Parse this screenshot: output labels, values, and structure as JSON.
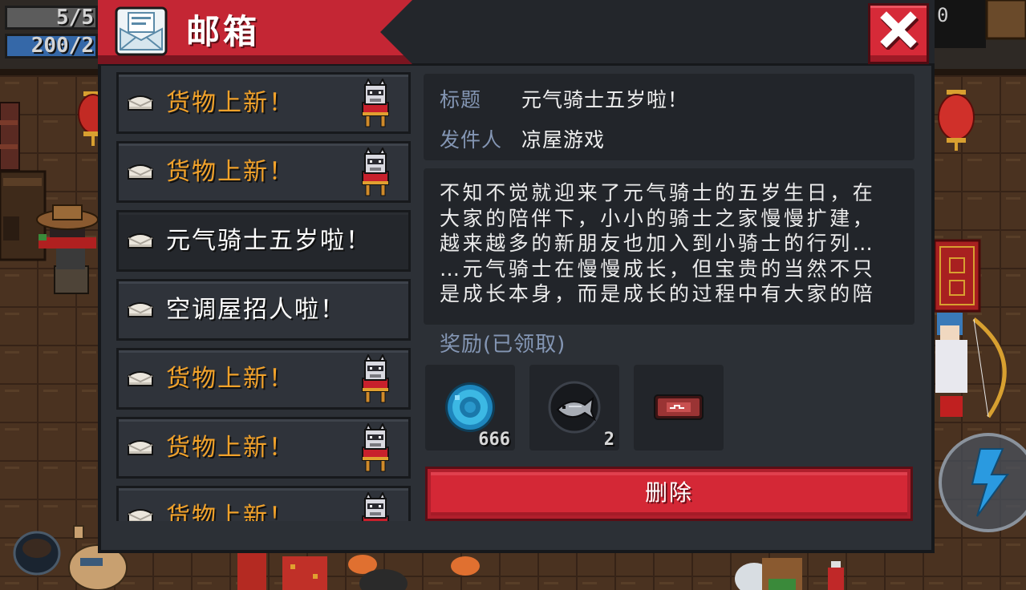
{
  "hud": {
    "health_text": "5/5",
    "energy_text": "200/2",
    "coin_text": "0"
  },
  "mailbox": {
    "title": "邮箱",
    "header_icon": "mail-envelope-icon",
    "close_icon": "close-icon"
  },
  "mail_list": [
    {
      "subject": "货物上新！",
      "color": "#f2a22a",
      "envelope_icon": "envelope-icon",
      "sender_icon": "merchant-cat-icon",
      "selected": false
    },
    {
      "subject": "货物上新！",
      "color": "#f2a22a",
      "envelope_icon": "envelope-icon",
      "sender_icon": "merchant-cat-icon",
      "selected": false
    },
    {
      "subject": "元气骑士五岁啦！",
      "color": "#ffffff",
      "envelope_icon": "envelope-icon",
      "sender_icon": null,
      "selected": true
    },
    {
      "subject": "空调屋招人啦！",
      "color": "#ffffff",
      "envelope_icon": "envelope-icon",
      "sender_icon": null,
      "selected": false
    },
    {
      "subject": "货物上新！",
      "color": "#f2a22a",
      "envelope_icon": "envelope-icon",
      "sender_icon": "merchant-cat-icon",
      "selected": false
    },
    {
      "subject": "货物上新！",
      "color": "#f2a22a",
      "envelope_icon": "envelope-icon",
      "sender_icon": "merchant-cat-icon",
      "selected": false
    },
    {
      "subject": "货物上新！",
      "color": "#f2a22a",
      "envelope_icon": "envelope-icon",
      "sender_icon": "merchant-cat-icon",
      "selected": false
    }
  ],
  "detail": {
    "title_label": "标题",
    "title": "元气骑士五岁啦！",
    "sender_label": "发件人",
    "sender": "凉屋游戏",
    "body_lines": [
      "不知不觉就迎来了元气骑士的五岁生日，在",
      "大家的陪伴下，小小的骑士之家慢慢扩建，",
      "越来越多的新朋友也加入到小骑士的行列…",
      "…元气骑士在慢慢成长，但宝贵的当然不只",
      "是成长本身，而是成长的过程中有大家的陪"
    ]
  },
  "rewards": {
    "label": "奖励(已领取)",
    "items": [
      {
        "icon": "blue-gem-icon",
        "count": "666"
      },
      {
        "icon": "fish-icon",
        "count": "2"
      },
      {
        "icon": "ticket-icon"
      }
    ]
  },
  "delete_button": {
    "label": "删除"
  },
  "skill_button": {
    "icon": "lightning-icon"
  },
  "colors": {
    "panel_background": "#2c3036",
    "header_red": "#c42634",
    "new_goods_orange": "#f2a22a",
    "label_blue_gray": "#8496b4",
    "delete_red": "#d42836",
    "close_red": "#d62a38",
    "gem_blue": "#2aa0d8",
    "skill_lightning_blue": "#2a9ae0"
  }
}
